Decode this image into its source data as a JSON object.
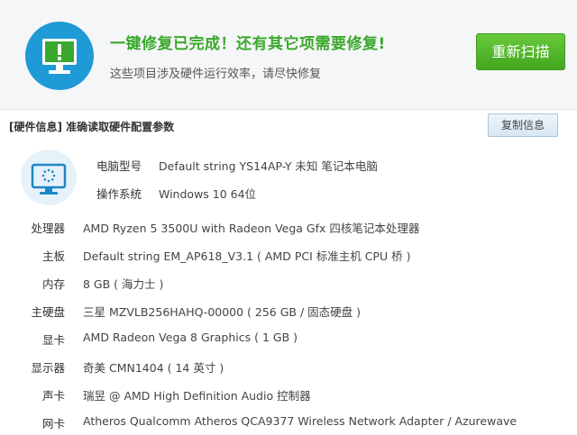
{
  "banner": {
    "title": "一键修复已完成！还有其它项需要修复!",
    "subtitle": "这些项目涉及硬件运行效率，请尽快修复",
    "rescan_label": "重新扫描",
    "icon": "monitor-exclamation-icon",
    "accent": "#1e9ad6",
    "title_color": "#3aa82c"
  },
  "section": {
    "title": "[硬件信息] 准确读取硬件配置参数",
    "copy_label": "复制信息"
  },
  "summary": [
    {
      "label": "电脑型号",
      "value": "Default string YS14AP-Y 未知 笔记本电脑"
    },
    {
      "label": "操作系统",
      "value": "Windows 10 64位"
    }
  ],
  "hardware": [
    {
      "label": "处理器",
      "value": "AMD Ryzen 5 3500U with Radeon Vega Gfx 四核笔记本处理器"
    },
    {
      "label": "主板",
      "value": "Default string EM_AP618_V3.1 ( AMD PCI 标准主机 CPU 桥 )"
    },
    {
      "label": "内存",
      "value": "8 GB ( 海力士 )"
    },
    {
      "label": "主硬盘",
      "value": "三星 MZVLB256HAHQ-00000 ( 256 GB / 固态硬盘 )"
    },
    {
      "label": "显卡",
      "value": "AMD Radeon Vega 8 Graphics ( 1 GB )"
    },
    {
      "label": "显示器",
      "value": "奇美 CMN1404 ( 14 英寸 )"
    },
    {
      "label": "声卡",
      "value": "瑞昱 @ AMD High Definition Audio 控制器"
    },
    {
      "label": "网卡",
      "value": "Atheros Qualcomm Atheros QCA9377 Wireless Network Adapter / Azurewave"
    }
  ]
}
